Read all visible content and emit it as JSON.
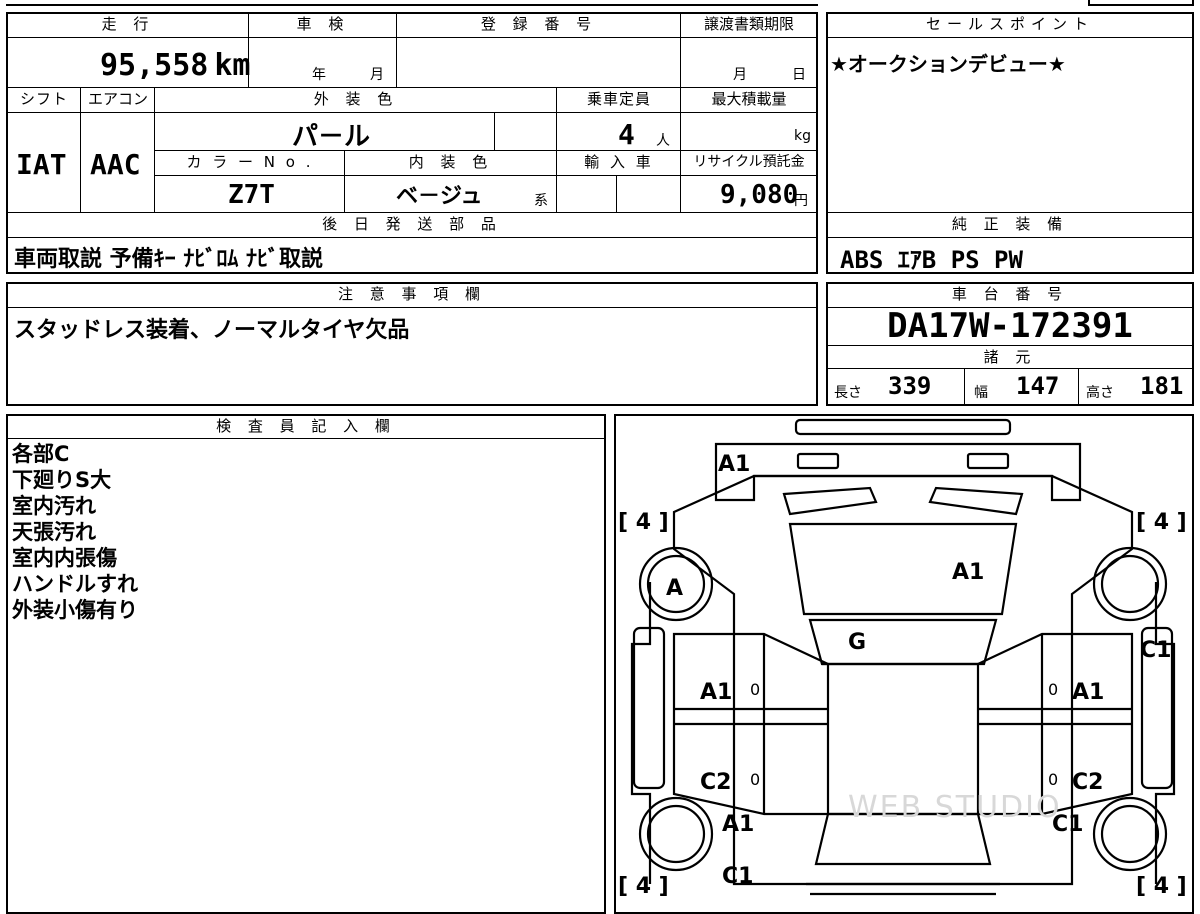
{
  "headers": {
    "mileage": "走 行",
    "inspection": "車 検",
    "registration": "登 録 番 号",
    "transfer_deadline": "譲渡書類期限",
    "sales_points": "セールスポイント",
    "shift": "シフト",
    "aircon": "エアコン",
    "exterior_color": "外 装 色",
    "capacity": "乗車定員",
    "max_load": "最大積載量",
    "color_no": "カ ラ ー N o .",
    "interior_color": "内 装 色",
    "import": "輸 入 車",
    "recycle": "リサイクル預託金",
    "later_parts": "後 日 発 送 部 品",
    "genuine_equipment": "純 正 装 備",
    "notes": "注 意 事 項 欄",
    "chassis_number": "車 台 番 号",
    "specs": "諸 元",
    "inspector_notes": "検 査 員 記 入 欄"
  },
  "values": {
    "mileage": "95,558",
    "mileage_unit": "km",
    "inspection_year_unit": "年",
    "inspection_month_unit": "月",
    "transfer_month_unit": "月",
    "transfer_day_unit": "日",
    "shift": "IAT",
    "aircon": "AAC",
    "exterior_color": "パ－ル",
    "capacity": "4",
    "capacity_unit": "人",
    "max_load_unit": "kg",
    "color_no": "Z7T",
    "interior_color": "ベ－ジュ",
    "interior_suffix": "系",
    "recycle_fee": "9,080",
    "recycle_unit": "円",
    "sales_point": "★オークションデビュー★",
    "later_parts": "車両取説 予備ｷｰ ﾅﾋﾞﾛﾑ ﾅﾋﾞ取説",
    "genuine_equipment": "ABS ｴｱB PS PW",
    "notes": "スタッドレス装着、ノーマルタイヤ欠品",
    "chassis_number": "DA17W-172391",
    "length_label": "長さ",
    "length": "339",
    "width_label": "幅",
    "width": "147",
    "height_label": "高さ",
    "height": "181"
  },
  "inspector_lines": [
    "各部C",
    "下廻りS大",
    "室内汚れ",
    "天張汚れ",
    "室内内張傷",
    "ハンドルすれ",
    "外装小傷有り"
  ],
  "diagram": {
    "tire_tl": "[ 4 ]",
    "tire_tr": "[ 4 ]",
    "tire_bl": "[ 4 ]",
    "tire_br": "[ 4 ]",
    "front_bumper": "A1",
    "hood": "A1",
    "front_left_fender": "A",
    "windshield": "G",
    "right_front_door": "C1",
    "left_front_door": "A1",
    "left_front_mark": "0",
    "right_front_door_inner": "A1",
    "right_front_mark": "0",
    "left_rear_door": "C2",
    "left_rear_mark": "0",
    "right_rear_door": "C2",
    "right_rear_mark": "0",
    "left_rear_fender": "A1",
    "right_rear_fender": "C1",
    "rear": "C1",
    "watermark": "WEB STUDIO"
  }
}
